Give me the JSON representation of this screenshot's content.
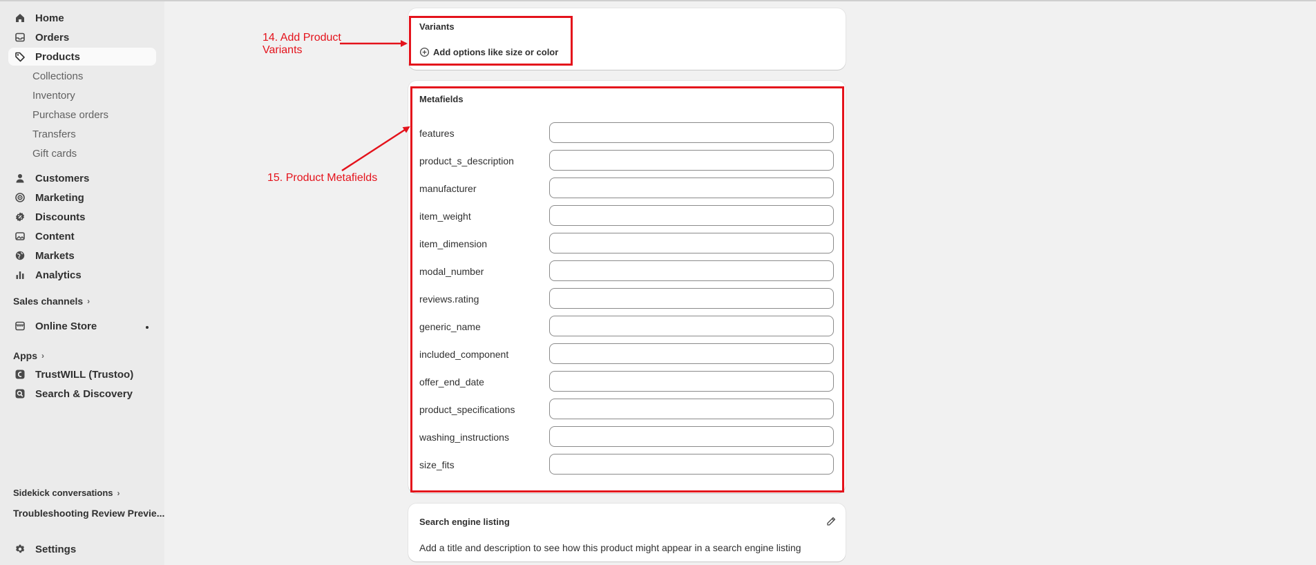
{
  "sidebar": {
    "main_items": [
      {
        "label": "Home",
        "icon": "home-icon"
      },
      {
        "label": "Orders",
        "icon": "inbox-icon"
      },
      {
        "label": "Products",
        "icon": "tag-icon"
      }
    ],
    "product_sub_items": [
      "Collections",
      "Inventory",
      "Purchase orders",
      "Transfers",
      "Gift cards"
    ],
    "other_items": [
      {
        "label": "Customers",
        "icon": "person-icon"
      },
      {
        "label": "Marketing",
        "icon": "target-icon"
      },
      {
        "label": "Discounts",
        "icon": "discount-icon"
      },
      {
        "label": "Content",
        "icon": "image-icon"
      },
      {
        "label": "Markets",
        "icon": "globe-icon"
      },
      {
        "label": "Analytics",
        "icon": "bar-chart-icon"
      }
    ],
    "sales_channels_label": "Sales channels",
    "online_store_label": "Online Store",
    "apps_label": "Apps",
    "apps": [
      {
        "label": "TrustWILL (Trustoo)",
        "icon": "app-icon"
      },
      {
        "label": "Search & Discovery",
        "icon": "search-icon"
      }
    ],
    "sidekick_label": "Sidekick conversations",
    "conversation_label": "Troubleshooting Review Previe...",
    "settings_label": "Settings"
  },
  "variants": {
    "title": "Variants",
    "add_options_label": "Add options like size or color"
  },
  "metafields": {
    "title": "Metafields",
    "fields": [
      {
        "label": "features",
        "value": ""
      },
      {
        "label": "product_s_description",
        "value": ""
      },
      {
        "label": "manufacturer",
        "value": ""
      },
      {
        "label": "item_weight",
        "value": ""
      },
      {
        "label": "item_dimension",
        "value": ""
      },
      {
        "label": "modal_number",
        "value": ""
      },
      {
        "label": "reviews.rating",
        "value": ""
      },
      {
        "label": "generic_name",
        "value": ""
      },
      {
        "label": "included_component",
        "value": ""
      },
      {
        "label": "offer_end_date",
        "value": ""
      },
      {
        "label": "product_specifications",
        "value": ""
      },
      {
        "label": "washing_instructions",
        "value": ""
      },
      {
        "label": "size_fits",
        "value": ""
      }
    ]
  },
  "seo": {
    "title": "Search engine listing",
    "description": "Add a title and description to see how this product might appear in a search engine listing"
  },
  "annotations": {
    "variants_line1": "14. Add Product",
    "variants_line2": "Variants",
    "metafields": "15. Product Metafields"
  },
  "colors": {
    "annotation_red": "#e4121b",
    "sidebar_bg": "#ebebeb",
    "page_bg": "#f1f1f1"
  }
}
